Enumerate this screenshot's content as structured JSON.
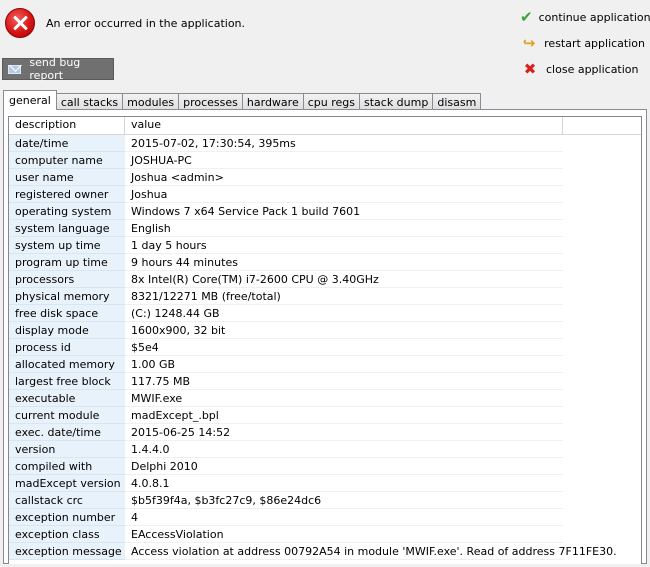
{
  "error": {
    "message": "An error occurred in the application."
  },
  "actions": {
    "continue_label": "continue application",
    "restart_label": "restart application",
    "close_label": "close application",
    "bug_report_label": "send bug report"
  },
  "tabs": [
    {
      "label": "general",
      "active": true
    },
    {
      "label": "call stacks"
    },
    {
      "label": "modules"
    },
    {
      "label": "processes"
    },
    {
      "label": "hardware"
    },
    {
      "label": "cpu regs"
    },
    {
      "label": "stack dump"
    },
    {
      "label": "disasm"
    }
  ],
  "table": {
    "headers": [
      "description",
      "value"
    ],
    "rows": [
      [
        "date/time",
        "2015-07-02, 17:30:54, 395ms"
      ],
      [
        "computer name",
        "JOSHUA-PC"
      ],
      [
        "user name",
        "Joshua  <admin>"
      ],
      [
        "registered owner",
        "Joshua"
      ],
      [
        "operating system",
        "Windows 7 x64 Service Pack 1 build 7601"
      ],
      [
        "system language",
        "English"
      ],
      [
        "system up time",
        "1 day 5 hours"
      ],
      [
        "program up time",
        "9 hours 44 minutes"
      ],
      [
        "processors",
        "8x Intel(R) Core(TM) i7-2600 CPU @ 3.40GHz"
      ],
      [
        "physical memory",
        "8321/12271 MB (free/total)"
      ],
      [
        "free disk space",
        "(C:) 1248.44 GB"
      ],
      [
        "display mode",
        "1600x900, 32 bit"
      ],
      [
        "process id",
        "$5e4"
      ],
      [
        "allocated memory",
        "1.00 GB"
      ],
      [
        "largest free block",
        "117.75 MB"
      ],
      [
        "executable",
        "MWIF.exe"
      ],
      [
        "current module",
        "madExcept_.bpl"
      ],
      [
        "exec. date/time",
        "2015-06-25 14:52"
      ],
      [
        "version",
        "1.4.4.0"
      ],
      [
        "compiled with",
        "Delphi 2010"
      ],
      [
        "madExcept version",
        "4.0.8.1"
      ],
      [
        "callstack crc",
        "$b5f39f4a, $b3fc27c9, $86e24dc6"
      ],
      [
        "exception number",
        "4"
      ],
      [
        "exception class",
        "EAccessViolation"
      ],
      [
        "exception message",
        "Access violation at address 00792A54 in module 'MWIF.exe'. Read of address 7F11FE30."
      ]
    ]
  },
  "icons": {
    "error": "error-circle-icon",
    "continue": "checkmark-icon",
    "restart": "restart-arrow-icon",
    "close": "close-x-icon",
    "bug_report": "envelope-icon"
  }
}
